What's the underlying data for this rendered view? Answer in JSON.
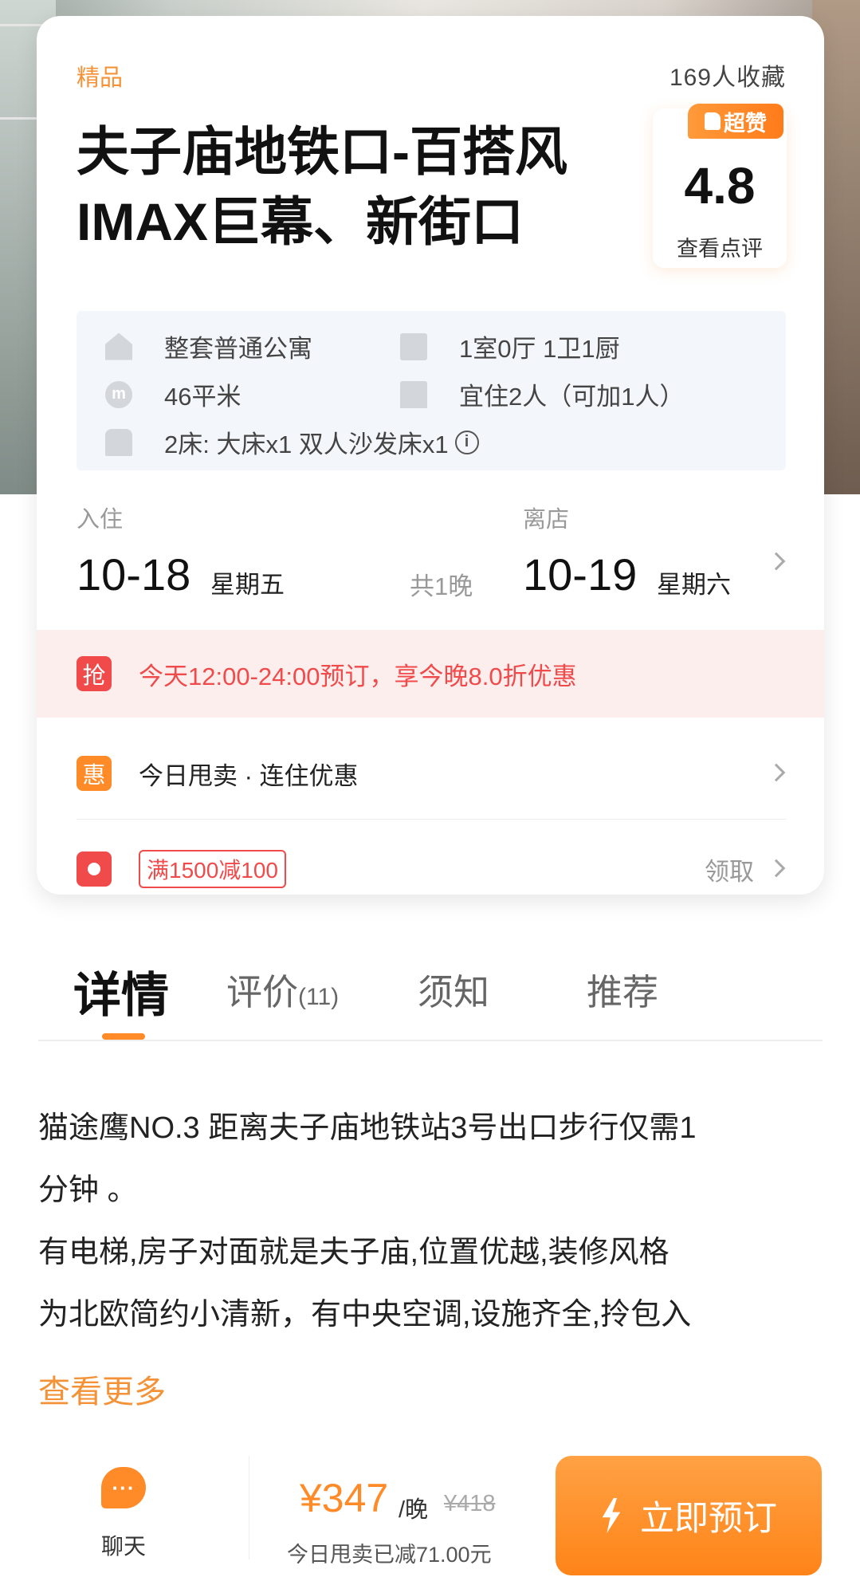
{
  "listing": {
    "tag": "精品",
    "favorites": "169人收藏",
    "title": "夫子庙地铁口-百搭风IMAX巨幕、新街口"
  },
  "rating": {
    "badge": "超赞",
    "score": "4.8",
    "link": "查看点评"
  },
  "info": {
    "type": "整套普通公寓",
    "layout": "1室0厅 1卫1厨",
    "area": "46平米",
    "guests": "宜住2人（可加1人）",
    "beds": "2床: 大床x1 双人沙发床x1",
    "area_icon_glyph": "m",
    "info_icon_glyph": "i"
  },
  "stay": {
    "checkin_label": "入住",
    "checkin_date": "10-18",
    "checkin_week": "星期五",
    "nights": "共1晚",
    "checkout_label": "离店",
    "checkout_date": "10-19",
    "checkout_week": "星期六"
  },
  "flash": {
    "icon_label": "抢",
    "text": "今天12:00-24:00预订，享今晚8.0折优惠"
  },
  "deal": {
    "icon_label": "惠",
    "text": "今日甩卖 · 连住优惠"
  },
  "coupon": {
    "tag": "满1500减100",
    "claim": "领取"
  },
  "tabs": {
    "details": "详情",
    "reviews": "评价",
    "reviews_count": "(11)",
    "rules": "须知",
    "recommend": "推荐"
  },
  "description": {
    "line1": "猫途鹰NO.3 距离夫子庙地铁站3号出口步行仅需1",
    "line2": "分钟 。",
    "line3": "有电梯,房子对面就是夫子庙,位置优越,装修风格",
    "line4": "为北欧简约小清新，有中央空调,设施齐全,拎包入",
    "more": "查看更多"
  },
  "bottom_bar": {
    "chat_label": "聊天",
    "chat_icon_glyph": "···",
    "price": "¥347",
    "per_night": "/晚",
    "original_price": "¥418",
    "discount_note": "今日甩卖已减71.00元",
    "book_label": "立即预订"
  },
  "colors": {
    "accent_orange": "#ff8a28",
    "alert_red": "#f04a4a"
  }
}
